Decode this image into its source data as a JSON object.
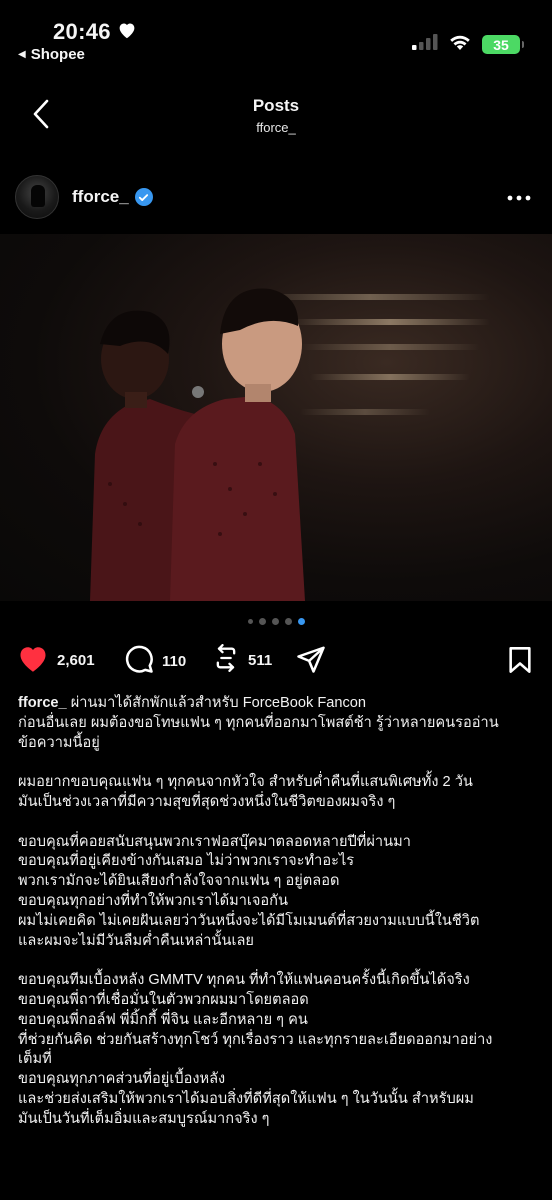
{
  "status_bar": {
    "time": "20:46",
    "back_app": "Shopee",
    "battery": "35"
  },
  "header": {
    "title": "Posts",
    "subtitle": "fforce_"
  },
  "post": {
    "username": "fforce_",
    "likes": "2,601",
    "comments": "110",
    "reposts": "511",
    "carousel": {
      "count": 5,
      "active_index": 4
    },
    "caption_first": "ผ่านมาได้สักพักแล้วสำหรับ ForceBook Fancon",
    "caption_lines": [
      "ก่อนอื่นเลย ผมต้องขอโทษแฟน ๆ ทุกคนที่ออกมาโพสต์ช้า รู้ว่าหลายคนรออ่าน",
      "ข้อความนี้อยู่",
      "",
      "ผมอยากขอบคุณแฟน ๆ ทุกคนจากหัวใจ สำหรับค่ำคืนที่แสนพิเศษทั้ง 2 วัน",
      "มันเป็นช่วงเวลาที่มีความสุขที่สุดช่วงหนึ่งในชีวิตของผมจริง ๆ",
      "",
      "ขอบคุณที่คอยสนับสนุนพวกเราฟอสบุ๊คมาตลอดหลายปีที่ผ่านมา",
      "ขอบคุณที่อยู่เคียงข้างกันเสมอ ไม่ว่าพวกเราจะทำอะไร",
      "พวกเรามักจะได้ยินเสียงกำลังใจจากแฟน ๆ อยู่ตลอด",
      "ขอบคุณทุกอย่างที่ทำให้พวกเราได้มาเจอกัน",
      "ผมไม่เคยคิด ไม่เคยฝันเลยว่าวันหนึ่งจะได้มีโมเมนต์ที่สวยงามแบบนี้ในชีวิต",
      "และผมจะไม่มีวันลืมค่ำคืนเหล่านั้นเลย",
      "",
      "ขอบคุณทีมเบื้องหลัง GMMTV ทุกคน ที่ทำให้แฟนคอนครั้งนี้เกิดขึ้นได้จริง",
      "ขอบคุณพี่ถาที่เชื่อมั่นในตัวพวกผมมาโดยตลอด",
      "ขอบคุณพี่กอล์ฟ พี่มิ้กกี้ พี่จิน และอีกหลาย ๆ คน",
      "ที่ช่วยกันคิด ช่วยกันสร้างทุกโชว์ ทุกเรื่องราว และทุกรายละเอียดออกมาอย่าง",
      "เต็มที่",
      "ขอบคุณทุกภาคส่วนที่อยู่เบื้องหลัง",
      "และช่วยส่งเสริมให้พวกเราได้มอบสิ่งที่ดีที่สุดให้แฟน ๆ ในวันนั้น สำหรับผม",
      "มันเป็นวันที่เต็มอิ่มและสมบูรณ์มากจริง ๆ"
    ]
  },
  "icons": {
    "status_heart": "heart-icon",
    "back_triangle": "back-triangle-icon",
    "signal": "cellular-signal-icon",
    "wifi": "wifi-icon",
    "battery": "battery-charging-icon",
    "back": "chevron-left-icon",
    "verified": "verified-badge-icon",
    "more": "more-horizontal-icon",
    "like": "heart-filled-icon",
    "comment": "comment-icon",
    "repost": "repost-icon",
    "share": "send-icon",
    "save": "bookmark-icon"
  },
  "colors": {
    "background": "#000000",
    "like_red": "#ff3040",
    "verified_blue": "#3897f0",
    "battery_green": "#4cd964",
    "active_dot": "#3897f0"
  }
}
